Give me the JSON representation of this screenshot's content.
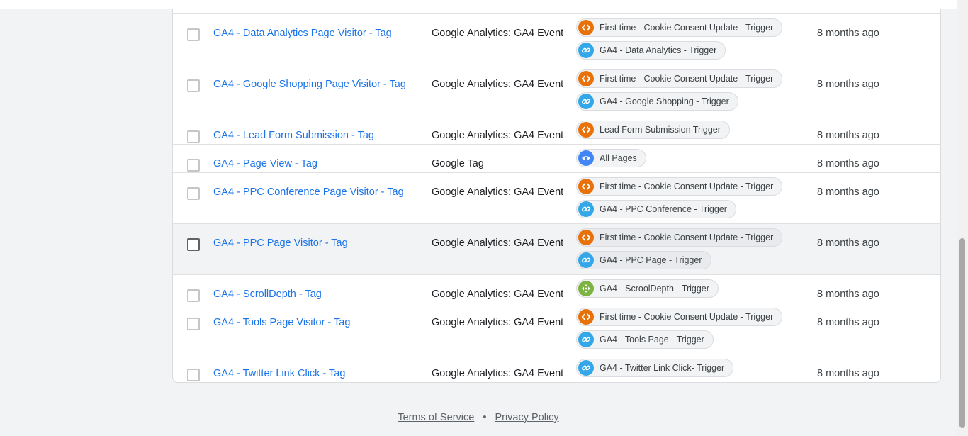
{
  "colors": {
    "link": "#1a73e8",
    "custom_event": "#e8710a",
    "link_click": "#33a7e8",
    "page_view": "#4285f4",
    "scroll_depth": "#7cb342"
  },
  "rows": [
    {
      "name": "GA4 - Data Analytics Page Visitor - Tag",
      "type": "Google Analytics: GA4 Event",
      "modified": "8 months ago",
      "triggers": [
        {
          "label": "First time - Cookie Consent Update - Trigger",
          "icon": "custom-event-icon"
        },
        {
          "label": "GA4 - Data Analytics - Trigger",
          "icon": "link-icon"
        }
      ]
    },
    {
      "name": "GA4 - Google Shopping Page Visitor - Tag",
      "type": "Google Analytics: GA4 Event",
      "modified": "8 months ago",
      "triggers": [
        {
          "label": "First time - Cookie Consent Update - Trigger",
          "icon": "custom-event-icon"
        },
        {
          "label": "GA4 - Google Shopping - Trigger",
          "icon": "link-icon"
        }
      ]
    },
    {
      "name": "GA4 - Lead Form Submission - Tag",
      "type": "Google Analytics: GA4 Event",
      "modified": "8 months ago",
      "triggers": [
        {
          "label": "Lead Form Submission Trigger",
          "icon": "custom-event-icon"
        }
      ]
    },
    {
      "name": "GA4 - Page View - Tag",
      "type": "Google Tag",
      "modified": "8 months ago",
      "triggers": [
        {
          "label": "All Pages",
          "icon": "eye-icon"
        }
      ]
    },
    {
      "name": "GA4 - PPC Conference Page Visitor - Tag",
      "type": "Google Analytics: GA4 Event",
      "modified": "8 months ago",
      "triggers": [
        {
          "label": "First time - Cookie Consent Update - Trigger",
          "icon": "custom-event-icon"
        },
        {
          "label": "GA4 - PPC Conference - Trigger",
          "icon": "link-icon"
        }
      ]
    },
    {
      "name": "GA4 - PPC Page Visitor - Tag",
      "type": "Google Analytics: GA4 Event",
      "modified": "8 months ago",
      "triggers": [
        {
          "label": "First time - Cookie Consent Update - Trigger",
          "icon": "custom-event-icon"
        },
        {
          "label": "GA4 - PPC Page - Trigger",
          "icon": "link-icon"
        }
      ]
    },
    {
      "name": "GA4 - ScrollDepth - Tag",
      "type": "Google Analytics: GA4 Event",
      "modified": "8 months ago",
      "triggers": [
        {
          "label": "GA4 - ScroolDepth - Trigger",
          "icon": "scroll-depth-icon"
        }
      ]
    },
    {
      "name": "GA4 - Tools Page Visitor - Tag",
      "type": "Google Analytics: GA4 Event",
      "modified": "8 months ago",
      "triggers": [
        {
          "label": "First time - Cookie Consent Update - Trigger",
          "icon": "custom-event-icon"
        },
        {
          "label": "GA4 - Tools Page - Trigger",
          "icon": "link-icon"
        }
      ]
    },
    {
      "name": "GA4 - Twitter Link Click - Tag",
      "type": "Google Analytics: GA4 Event",
      "modified": "8 months ago",
      "triggers": [
        {
          "label": "GA4 - Twitter Link Click- Trigger",
          "icon": "link-icon"
        }
      ]
    }
  ],
  "footer": {
    "terms": "Terms of Service",
    "separator": "•",
    "privacy": "Privacy Policy"
  }
}
